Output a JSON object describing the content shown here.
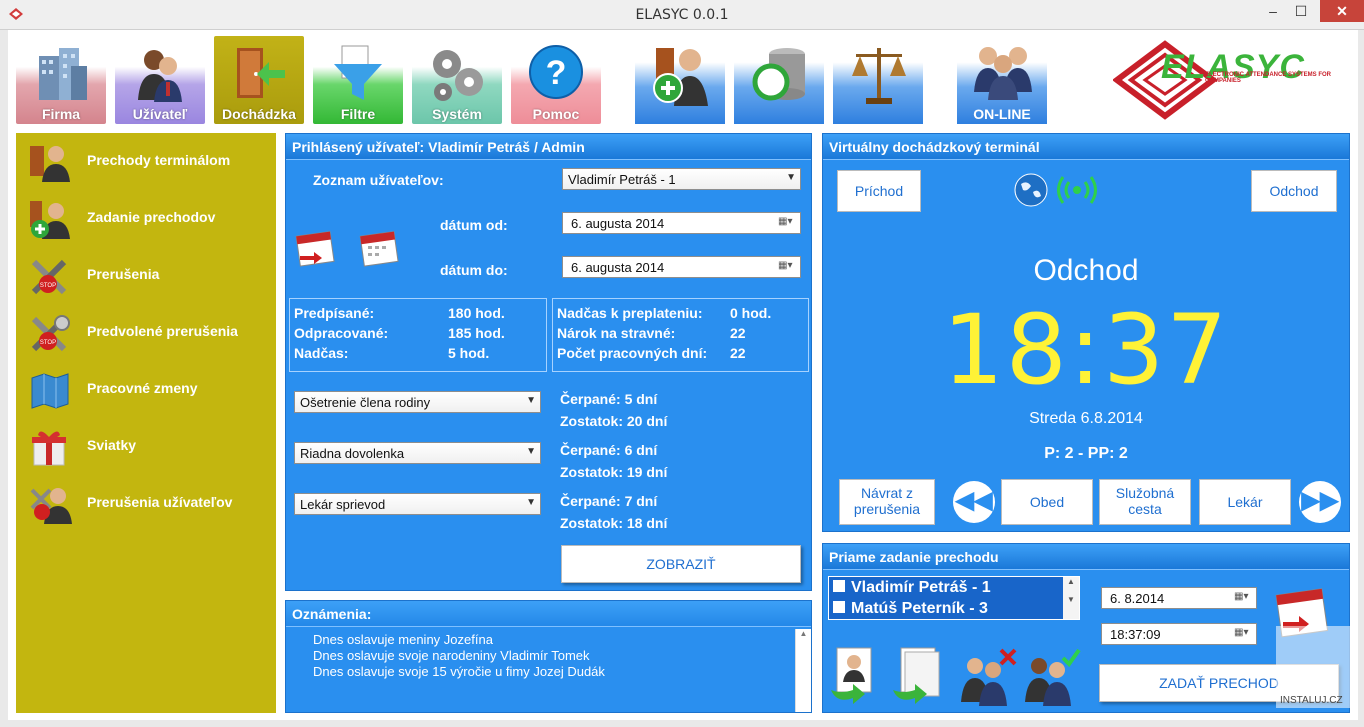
{
  "window": {
    "title": "ELASYC 0.0.1",
    "min": "–",
    "max": "☐",
    "close": "✕"
  },
  "toolbar": {
    "firma": "Firma",
    "uzivatel": "Užívateľ",
    "dochadzka": "Dochádzka",
    "filtre": "Filtre",
    "system": "Systém",
    "pomoc": "Pomoc",
    "online": "ON-LINE"
  },
  "logo": {
    "text": "ELASYC",
    "subtitle": "ELECTRONIC ATTENDANCE SYSTEMS FOR COMPANIES"
  },
  "sidebar": {
    "items": [
      {
        "label": "Prechody terminálom",
        "icon": "door-user-icon"
      },
      {
        "label": "Zadanie prechodov",
        "icon": "add-user-icon"
      },
      {
        "label": "Prerušenia",
        "icon": "tools-stop-icon"
      },
      {
        "label": "Predvolené prerušenia",
        "icon": "tools-stop-gear-icon"
      },
      {
        "label": "Pracovné zmeny",
        "icon": "map-icon"
      },
      {
        "label": "Sviatky",
        "icon": "gift-icon"
      },
      {
        "label": "Prerušenia užívateľov",
        "icon": "user-stop-icon"
      }
    ]
  },
  "main": {
    "header": "Prihlásený užívateľ: Vladimír Petráš / Admin",
    "users_label": "Zoznam užívateľov:",
    "users_selected": "Vladimír Petráš - 1",
    "date_from_label": "dátum od:",
    "date_from": "6.   augusta   2014",
    "date_to_label": "dátum do:",
    "date_to": "6.   augusta   2014",
    "stats_left": [
      {
        "k": "Predpísané:",
        "v": "180 hod."
      },
      {
        "k": "Odpracované:",
        "v": "185 hod."
      },
      {
        "k": "Nadčas:",
        "v": "5 hod."
      }
    ],
    "stats_right": [
      {
        "k": "Nadčas k preplateniu:",
        "v": "0 hod."
      },
      {
        "k": "Nárok na stravné:",
        "v": "22"
      },
      {
        "k": "Počet pracovných dní:",
        "v": "22"
      }
    ],
    "absences": [
      {
        "type": "Ošetrenie člena rodiny",
        "used": "Čerpané: 5 dní",
        "left": "Zostatok: 20 dní"
      },
      {
        "type": "Riadna dovolenka",
        "used": "Čerpané: 6 dní",
        "left": "Zostatok: 19 dní"
      },
      {
        "type": "Lekár sprievod",
        "used": "Čerpané: 7 dní",
        "left": "Zostatok: 18 dní"
      }
    ],
    "show_button": "ZOBRAZIŤ"
  },
  "notifications": {
    "header": "Oznámenia:",
    "lines": [
      "Dnes oslavuje meniny Jozefína",
      "Dnes oslavuje svoje narodeniny Vladimír Tomek",
      "Dnes oslavuje svoje 15 výročie u fimy Jozej Dudák"
    ]
  },
  "terminal": {
    "header": "Virtuálny dochádzkový terminál",
    "arrival": "Príchod",
    "departure": "Odchod",
    "mode": "Odchod",
    "clock": "18:37",
    "date": "Streda 6.8.2014",
    "counts": "P: 2 - PP: 2",
    "btn_return": "Návrat z prerušenia",
    "btn_prev": "◀◀",
    "btn_lunch": "Obed",
    "btn_trip": "Služobná cesta",
    "btn_doctor": "Lekár",
    "btn_next": "▶▶"
  },
  "direct": {
    "header": "Priame zadanie prechodu",
    "users": [
      "Vladimír Petráš - 1",
      "Matúš Peterník - 3"
    ],
    "date": "6.  8.2014",
    "time": "18:37:09",
    "submit": "ZADAŤ PRECHOD"
  },
  "watermark": "INSTALUJ.CZ",
  "colors": {
    "accent": "#2a8fef",
    "sidebar": "#c3b60f",
    "clock": "#fff236"
  }
}
